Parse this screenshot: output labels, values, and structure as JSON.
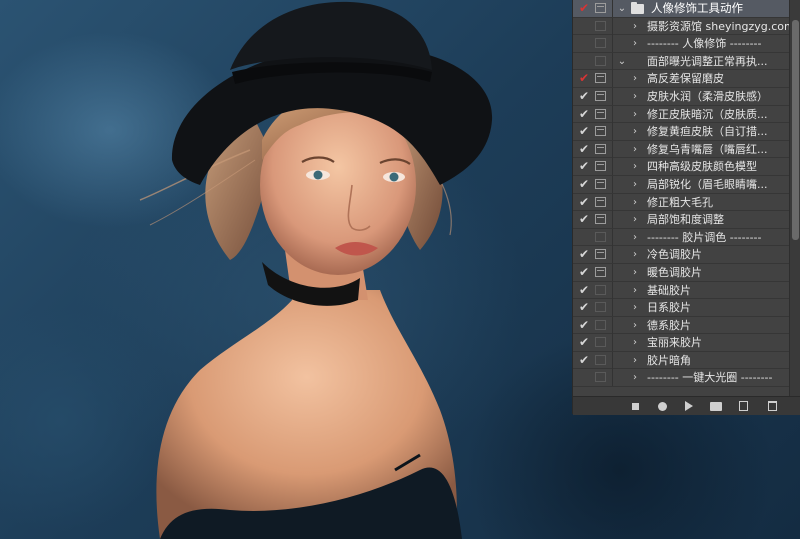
{
  "actions_panel": {
    "rows": [
      {
        "check": "✔",
        "check_color": "red",
        "dialog": true,
        "toggle": "down",
        "folder": true,
        "label": "人像修饰工具动作",
        "selected": true
      },
      {
        "check": "",
        "check_color": "",
        "dialog": false,
        "toggle": "right",
        "folder": false,
        "label": "摄影资源馆 sheyingzyg.com",
        "selected": false
      },
      {
        "check": "",
        "check_color": "",
        "dialog": false,
        "toggle": "right",
        "folder": false,
        "label": "-------- 人像修饰 --------",
        "selected": false
      },
      {
        "check": "",
        "check_color": "",
        "dialog": false,
        "toggle": "down",
        "folder": false,
        "label": "面部曝光调整正常再执...",
        "selected": false
      },
      {
        "check": "✔",
        "check_color": "red",
        "dialog": true,
        "toggle": "right",
        "folder": false,
        "label": "高反差保留磨皮",
        "selected": false
      },
      {
        "check": "✔",
        "check_color": "",
        "dialog": true,
        "toggle": "right",
        "folder": false,
        "label": "皮肤水润（柔滑皮肤感）",
        "selected": false
      },
      {
        "check": "✔",
        "check_color": "",
        "dialog": true,
        "toggle": "right",
        "folder": false,
        "label": "修正皮肤暗沉（皮肤质...",
        "selected": false
      },
      {
        "check": "✔",
        "check_color": "",
        "dialog": true,
        "toggle": "right",
        "folder": false,
        "label": "修复黄疸皮肤（自订措...",
        "selected": false
      },
      {
        "check": "✔",
        "check_color": "",
        "dialog": true,
        "toggle": "right",
        "folder": false,
        "label": "修复乌青嘴唇（嘴唇红...",
        "selected": false
      },
      {
        "check": "✔",
        "check_color": "",
        "dialog": true,
        "toggle": "right",
        "folder": false,
        "label": "四种高级皮肤颜色模型",
        "selected": false
      },
      {
        "check": "✔",
        "check_color": "",
        "dialog": true,
        "toggle": "right",
        "folder": false,
        "label": "局部锐化（眉毛眼睛嘴...",
        "selected": false
      },
      {
        "check": "✔",
        "check_color": "",
        "dialog": true,
        "toggle": "right",
        "folder": false,
        "label": "修正粗大毛孔",
        "selected": false
      },
      {
        "check": "✔",
        "check_color": "",
        "dialog": true,
        "toggle": "right",
        "folder": false,
        "label": "局部饱和度调整",
        "selected": false
      },
      {
        "check": "",
        "check_color": "",
        "dialog": false,
        "toggle": "right",
        "folder": false,
        "label": "-------- 胶片调色 --------",
        "selected": false
      },
      {
        "check": "✔",
        "check_color": "",
        "dialog": true,
        "toggle": "right",
        "folder": false,
        "label": "冷色调胶片",
        "selected": false
      },
      {
        "check": "✔",
        "check_color": "",
        "dialog": true,
        "toggle": "right",
        "folder": false,
        "label": "暖色调胶片",
        "selected": false
      },
      {
        "check": "✔",
        "check_color": "",
        "dialog": false,
        "toggle": "right",
        "folder": false,
        "label": "基础胶片",
        "selected": false
      },
      {
        "check": "✔",
        "check_color": "",
        "dialog": false,
        "toggle": "right",
        "folder": false,
        "label": "日系胶片",
        "selected": false
      },
      {
        "check": "✔",
        "check_color": "",
        "dialog": false,
        "toggle": "right",
        "folder": false,
        "label": "德系胶片",
        "selected": false
      },
      {
        "check": "✔",
        "check_color": "",
        "dialog": false,
        "toggle": "right",
        "folder": false,
        "label": "宝丽来胶片",
        "selected": false
      },
      {
        "check": "✔",
        "check_color": "",
        "dialog": false,
        "toggle": "right",
        "folder": false,
        "label": "胶片暗角",
        "selected": false
      },
      {
        "check": "",
        "check_color": "",
        "dialog": false,
        "toggle": "right",
        "folder": false,
        "label": "-------- 一键大光圈 --------",
        "selected": false
      }
    ],
    "toolbar": [
      {
        "name": "stop-button",
        "icon": "stop-icon"
      },
      {
        "name": "record-button",
        "icon": "record-icon"
      },
      {
        "name": "play-button",
        "icon": "play-icon"
      },
      {
        "name": "new-set-button",
        "icon": "folder-icon"
      },
      {
        "name": "new-action-button",
        "icon": "new-action-icon"
      },
      {
        "name": "delete-button",
        "icon": "trash-icon"
      }
    ]
  },
  "colors": {
    "panel_bg": "#424242",
    "selected_row": "#555a63",
    "red_check": "#d83434",
    "photo_bg": "#1d3a52"
  }
}
